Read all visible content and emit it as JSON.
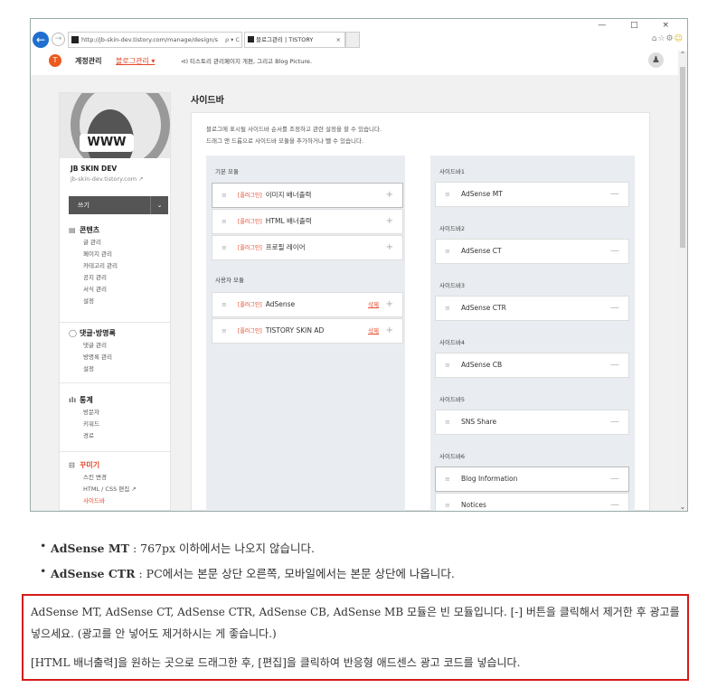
{
  "browser": {
    "url": "http://jb-skin-dev.tistory.com/manage/design/s",
    "url_controls": "ρ ▾ C",
    "tab_title": "블로그관리 | TISTORY",
    "tab_close": "×",
    "window_controls": "— □ ×",
    "toolbar_icons": [
      "home-icon",
      "star-icon",
      "gear-icon",
      "smiley-icon"
    ]
  },
  "blogbar": {
    "account": "계정관리",
    "admin": "블로그관리 ▾",
    "notice": "⊲) 티스토리 관리페이지 개편, 그리고 Blog Picture."
  },
  "sidebar": {
    "logo_text": "WWW",
    "blog_name": "JB SKIN DEV",
    "blog_url": "jb-skin-dev.tistory.com ↗",
    "write": "쓰기",
    "write_arrow": "⌄",
    "sections": [
      {
        "title": "콘텐츠",
        "icon": "document-icon",
        "items": [
          "글 관리",
          "페이지 관리",
          "카테고리 관리",
          "공지 관리",
          "서식 관리",
          "설정"
        ]
      },
      {
        "title": "댓글·방명록",
        "icon": "comment-icon",
        "items": [
          "댓글 관리",
          "방명록 관리",
          "설정"
        ]
      },
      {
        "title": "통계",
        "icon": "chart-icon",
        "items": [
          "방문자",
          "키워드",
          "경로"
        ]
      },
      {
        "title": "꾸미기",
        "icon": "palette-icon",
        "items": [
          "스킨 변경",
          "HTML / CSS 편집 ↗",
          "사이드바"
        ]
      }
    ]
  },
  "main": {
    "title": "사이드바",
    "desc1": "블로그에 표시될 사이드바 순서를 조정하고 관련 설정을 할 수 있습니다.",
    "desc2": "드래그 앤 드롭으로 사이드바 모듈을 추가하거나 뺄 수 있습니다.",
    "basic_title": "기본 모듈",
    "basic_modules": [
      {
        "tag": "[플러그인]",
        "name": "이미지 배너출력"
      },
      {
        "tag": "[플러그인]",
        "name": "HTML 배너출력"
      },
      {
        "tag": "[플러그인]",
        "name": "프로필 레이어"
      }
    ],
    "user_title": "사용자 모듈",
    "user_modules": [
      {
        "tag": "[플러그인]",
        "name": "AdSense",
        "del": "삭제"
      },
      {
        "tag": "[플러그인]",
        "name": "TISTORY SKIN AD",
        "del": "삭제"
      }
    ],
    "plus": "+",
    "minus": "—",
    "grip": "≡",
    "sidebars": [
      {
        "title": "사이드바1",
        "modules": [
          "AdSense MT"
        ]
      },
      {
        "title": "사이드바2",
        "modules": [
          "AdSense CT"
        ]
      },
      {
        "title": "사이드바3",
        "modules": [
          "AdSense CTR"
        ]
      },
      {
        "title": "사이드바4",
        "modules": [
          "AdSense CB"
        ]
      },
      {
        "title": "사이드바5",
        "modules": [
          "SNS Share"
        ]
      },
      {
        "title": "사이드바6",
        "modules": [
          "Blog Information",
          "Notices"
        ]
      }
    ]
  },
  "article": {
    "bullets": [
      {
        "term": "AdSense MT",
        "text": " : 767px 이하에서는 나오지 않습니다."
      },
      {
        "term": "AdSense CTR",
        "text": " : PC에서는 본문 상단 오른쪽, 모바일에서는 본문 상단에 나옵니다."
      }
    ],
    "note1": "AdSense MT, AdSense CT, AdSense CTR, AdSense CB, AdSense MB 모듈은 빈 모듈입니다. [-] 버튼을 클릭해서 제거한 후 광고를 넣으세요. (광고를 안 넣어도 제거하시는 게 좋습니다.)",
    "note2": "[HTML 배너출력]을 원하는 곳으로 드래그한 후, [편집]을 클릭하여 반응형 애드센스 광고 코드를 넣습니다.",
    "note_border_color": "#d41a1a"
  }
}
